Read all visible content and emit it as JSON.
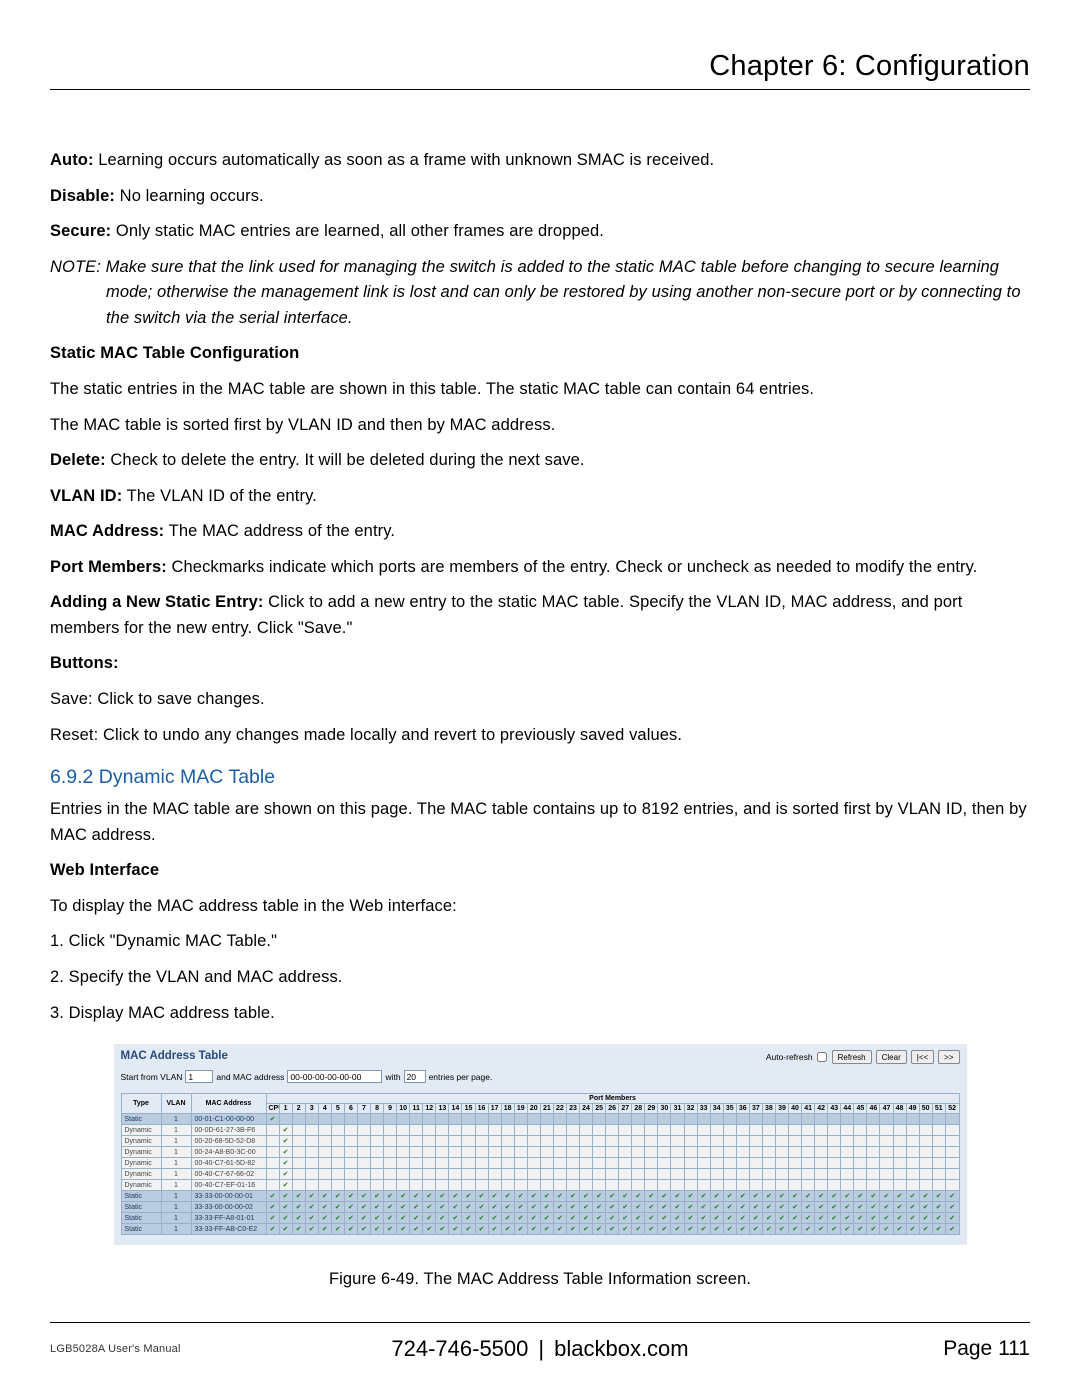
{
  "header": {
    "chapter_title": "Chapter 6: Configuration"
  },
  "body": {
    "auto": {
      "label": "Auto:",
      "text": " Learning occurs automatically as soon as a frame with unknown SMAC is received."
    },
    "disable": {
      "label": "Disable:",
      "text": " No learning occurs."
    },
    "secure": {
      "label": "Secure:",
      "text": " Only static MAC entries are learned, all other frames are dropped."
    },
    "note": {
      "label": "NOTE:",
      "line1": " Make sure that the link used for managing the switch is added to the static MAC table before changing to secure learning",
      "line2": "mode; otherwise the management link is lost and can only be restored by using another non-secure port or by connecting to the switch via the serial interface."
    },
    "static_head": "Static MAC Table Configuration",
    "static_p1": "The static entries in the MAC table are shown in this table. The static MAC table can contain 64 entries.",
    "static_p2": "The MAC table is sorted first by VLAN ID and then by MAC address.",
    "delete": {
      "label": "Delete:",
      "text": " Check to delete the entry. It will be deleted during the next save."
    },
    "vlanid": {
      "label": "VLAN ID:",
      "text": " The VLAN ID of the entry."
    },
    "macaddr": {
      "label": "MAC Address:",
      "text": " The MAC address of the entry."
    },
    "portmem": {
      "label": "Port Members:",
      "text": " Checkmarks indicate which ports are members of the entry. Check or uncheck as needed to modify the entry."
    },
    "adding": {
      "label": "Adding a New Static Entry:",
      "text": " Click to add a new entry to the static MAC table. Specify the VLAN ID, MAC address, and port members for the new entry. Click \"Save.\""
    },
    "buttons_head": "Buttons:",
    "save_btn": "Save: Click to save changes.",
    "reset_btn": "Reset: Click to undo any changes made locally and revert to previously saved values.",
    "dyn_title": "6.9.2 Dynamic MAC Table",
    "dyn_intro": "Entries in the MAC table are shown on this page. The MAC table contains up to 8192 entries, and is sorted first by VLAN ID, then by MAC address.",
    "web_head": "Web Interface",
    "web_intro": "To display the MAC address table in the Web interface:",
    "step1": "1. Click \"Dynamic MAC Table.\"",
    "step2": "2. Specify the VLAN and MAC address.",
    "step3": "3. Display MAC address table."
  },
  "panel": {
    "title": "MAC Address Table",
    "auto_refresh_label": "Auto-refresh",
    "refresh_btn": "Refresh",
    "clear_btn": "Clear",
    "prev_btn": "|<<",
    "next_btn": ">>",
    "filter": {
      "start_label": "Start from VLAN",
      "vlan_value": "1",
      "and_mac_label": "and MAC address",
      "mac_value": "00-00-00-00-00-00",
      "with_label": "with",
      "count_value": "20",
      "entries_label": "entries per page."
    },
    "port_members_header": "Port Members",
    "cols": {
      "type": "Type",
      "vlan": "VLAN",
      "mac": "MAC Address",
      "cpu": "CPU"
    },
    "port_count": 52,
    "rows": [
      {
        "type": "Static",
        "vlan": "1",
        "mac": "00-01-C1-00-00-00",
        "pattern": "cpu"
      },
      {
        "type": "Dynamic",
        "vlan": "1",
        "mac": "00-0D-61-27-3B-F6",
        "pattern": "p1"
      },
      {
        "type": "Dynamic",
        "vlan": "1",
        "mac": "00-20-68-5D-52-D8",
        "pattern": "p1"
      },
      {
        "type": "Dynamic",
        "vlan": "1",
        "mac": "00-24-A8-B0-3C-00",
        "pattern": "p1"
      },
      {
        "type": "Dynamic",
        "vlan": "1",
        "mac": "00-40-C7-61-5D-82",
        "pattern": "p1"
      },
      {
        "type": "Dynamic",
        "vlan": "1",
        "mac": "00-40-C7-67-66-02",
        "pattern": "p1"
      },
      {
        "type": "Dynamic",
        "vlan": "1",
        "mac": "00-40-C7-EF-01-16",
        "pattern": "p1"
      },
      {
        "type": "Static",
        "vlan": "1",
        "mac": "33-33-00-00-00-01",
        "pattern": "all"
      },
      {
        "type": "Static",
        "vlan": "1",
        "mac": "33-33-00-00-00-02",
        "pattern": "all"
      },
      {
        "type": "Static",
        "vlan": "1",
        "mac": "33-33-FF-A8-01-01",
        "pattern": "all"
      },
      {
        "type": "Static",
        "vlan": "1",
        "mac": "33-33-FF-AB-C0-E2",
        "pattern": "all"
      }
    ]
  },
  "figure_caption": "Figure 6-49. The MAC Address Table Information screen.",
  "footer": {
    "manual": "LGB5028A User's Manual",
    "phone": "724-746-5500",
    "site": "blackbox.com",
    "page_label": "Page 111"
  }
}
